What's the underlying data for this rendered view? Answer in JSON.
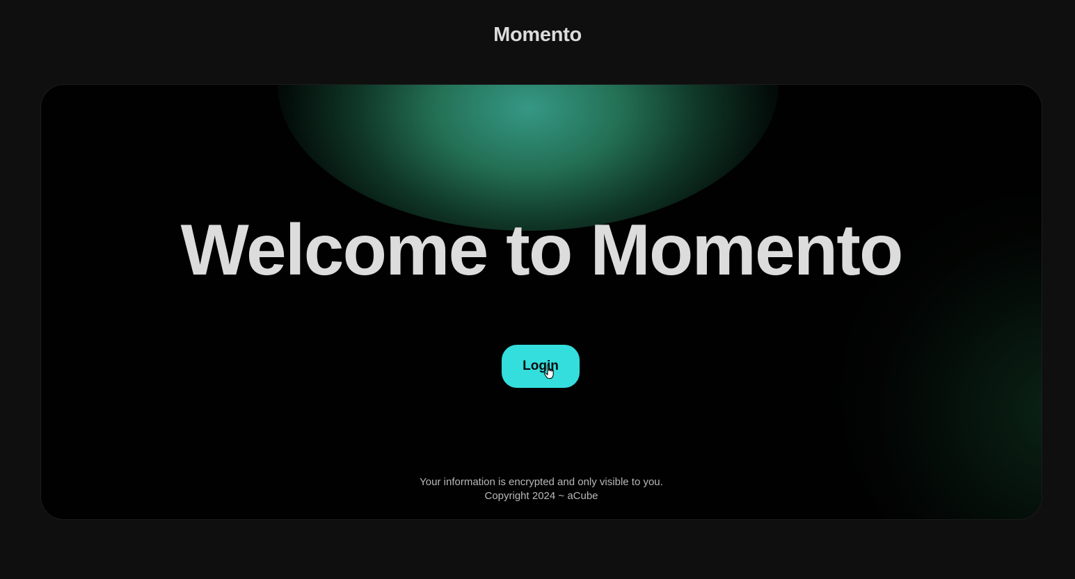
{
  "header": {
    "app_title": "Momento"
  },
  "hero": {
    "headline": "Welcome to Momento",
    "login_label": "Login"
  },
  "footer": {
    "privacy_note": "Your information is encrypted and only visible to you.",
    "copyright": "Copyright 2024 ~ aCube"
  },
  "colors": {
    "page_background": "#0f0f0f",
    "card_background": "#010101",
    "accent_button": "#33dedd",
    "glow_green": "#2c8c6a",
    "text_primary": "#dcdcdc"
  },
  "icons": {
    "cursor": "hand-pointer-icon"
  }
}
